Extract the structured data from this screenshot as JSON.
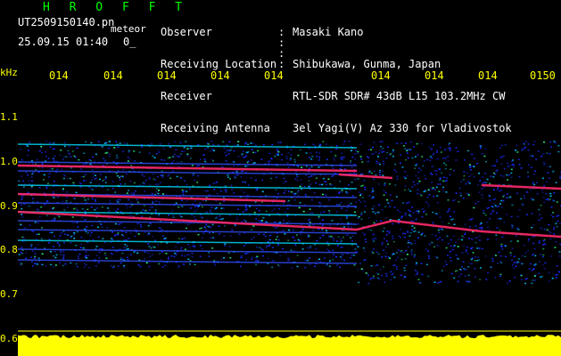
{
  "header": {
    "brand": "H R O F F T",
    "file_name": "UT2509150140.pn",
    "mode": "meteor",
    "datetime": "25.09.15 01:40",
    "small_value": "0_",
    "meta": [
      {
        "label": "Observer",
        "value": "Masaki Kano"
      },
      {
        "label": "Receiving Location",
        "value": "Shibukawa, Gunma, Japan"
      },
      {
        "label": "Receiver",
        "value": "RTL-SDR SDR# 43dB L15 103.2MHz CW"
      },
      {
        "label": "Receiving Antenna",
        "value": "3el Yagi(V) Az 330 for Vladivostok"
      }
    ]
  },
  "time_ticks": [
    "014",
    "014",
    "014",
    "014",
    "014",
    "014",
    "014",
    "014",
    "0150"
  ],
  "y_axis": {
    "unit": "kHz",
    "labels": [
      "1.1",
      "1.0",
      "0.9",
      "0.8",
      "0.7",
      "0.6"
    ]
  },
  "colors": {
    "background": "#000000",
    "text_yellow": "#ffff00",
    "text_green": "#00ff00",
    "noise_blue": "#1a2cff",
    "signal_red": "#ff2a6a",
    "baseline_fill": "#ffff00"
  }
}
